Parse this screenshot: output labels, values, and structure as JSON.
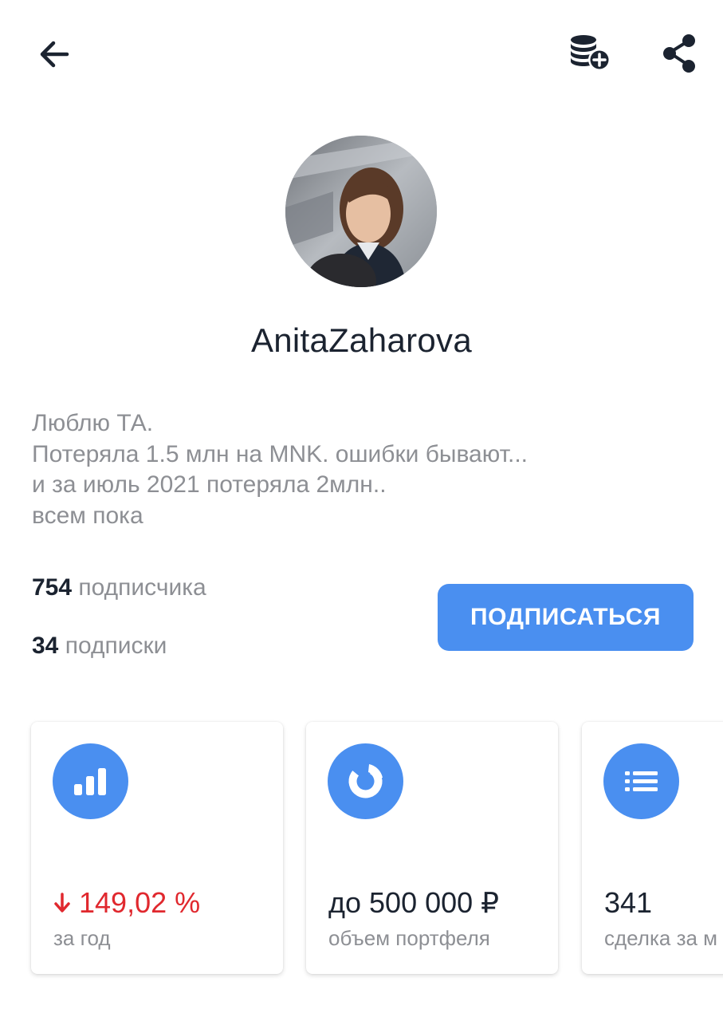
{
  "profile": {
    "username": "AnitaZaharova",
    "bio_lines": [
      "Люблю ТА.",
      "Потеряла 1.5 млн на MNK.  ошибки бывают...",
      "и за июль 2021 потеряла 2млн..",
      "всем пока"
    ]
  },
  "stats": {
    "followers_count": "754",
    "followers_label": "подписчика",
    "following_count": "34",
    "following_label": "подписки"
  },
  "actions": {
    "subscribe_label": "ПОДПИСАТЬСЯ"
  },
  "cards": [
    {
      "icon": "bar-chart-icon",
      "value": "149,02 %",
      "label": "за год",
      "trend": "down"
    },
    {
      "icon": "donut-chart-icon",
      "value": "до 500 000 ₽",
      "label": "объем портфеля"
    },
    {
      "icon": "list-icon",
      "value": "341",
      "label": "сделка за м"
    }
  ],
  "icons": {
    "back": "arrow-left-icon",
    "add_coins": "coins-add-icon",
    "share": "share-icon"
  },
  "colors": {
    "accent": "#4a8ff0",
    "negative": "#e0282e",
    "text_primary": "#1b2330",
    "text_secondary": "#8d8f94"
  }
}
